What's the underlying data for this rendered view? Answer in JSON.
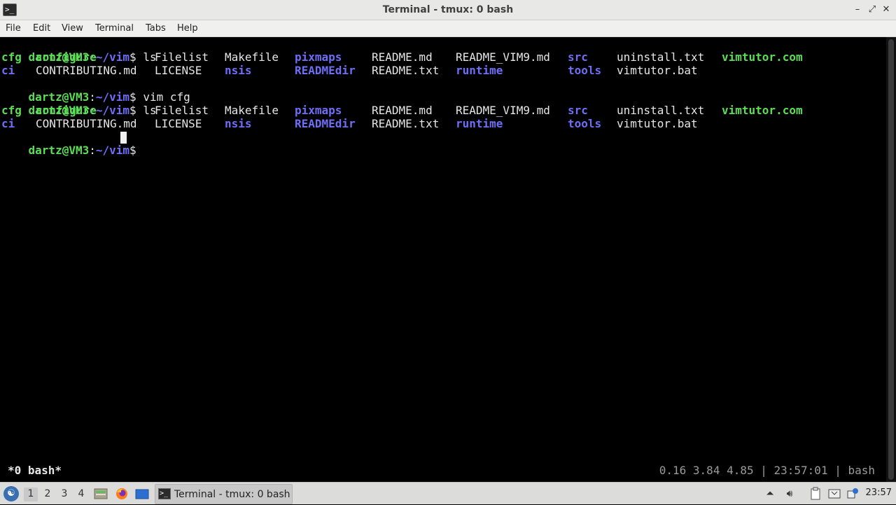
{
  "window": {
    "title": "Terminal - tmux: 0 bash",
    "app_icon_glyph": ">_",
    "minimize_glyph": "–",
    "maximize_glyph": "⤢",
    "close_glyph": "✕"
  },
  "menu": [
    "File",
    "Edit",
    "View",
    "Terminal",
    "Tabs",
    "Help"
  ],
  "terminal": {
    "colors": {
      "prompt": "#5bde55",
      "directory": "#6e6ef7",
      "executable": "#5bde55",
      "text": "#e6e6e6",
      "background": "#000000"
    },
    "prompt_user_host": "dartz@VM3",
    "prompt_colon": ":",
    "prompt_path": "~/vim",
    "prompt_symbol": "$",
    "cmd1": " ls",
    "cmd2": " vim cfg",
    "cmd3": " ls",
    "ls_row1": [
      "cfg",
      "configure",
      "Filelist",
      "Makefile",
      "pixmaps",
      "README.md",
      "README_VIM9.md",
      "src",
      "uninstall.txt",
      "vimtutor.com"
    ],
    "ls_row2": [
      "ci",
      "CONTRIBUTING.md",
      "LICENSE",
      "nsis",
      "READMEdir",
      "README.txt",
      "runtime",
      "tools",
      "vimtutor.bat"
    ]
  },
  "tmux": {
    "window_label": "*0 bash*",
    "status_right": "0.16 3.84 4.85 | 23:57:01 | bash"
  },
  "taskbar": {
    "start_icon": "start-menu-icon",
    "workspaces": [
      "1",
      "2",
      "3",
      "4"
    ],
    "active_workspace": "1",
    "task_label": "Terminal - tmux: 0 bash",
    "task_icon_glyph": ">_",
    "clock": "23:57"
  }
}
